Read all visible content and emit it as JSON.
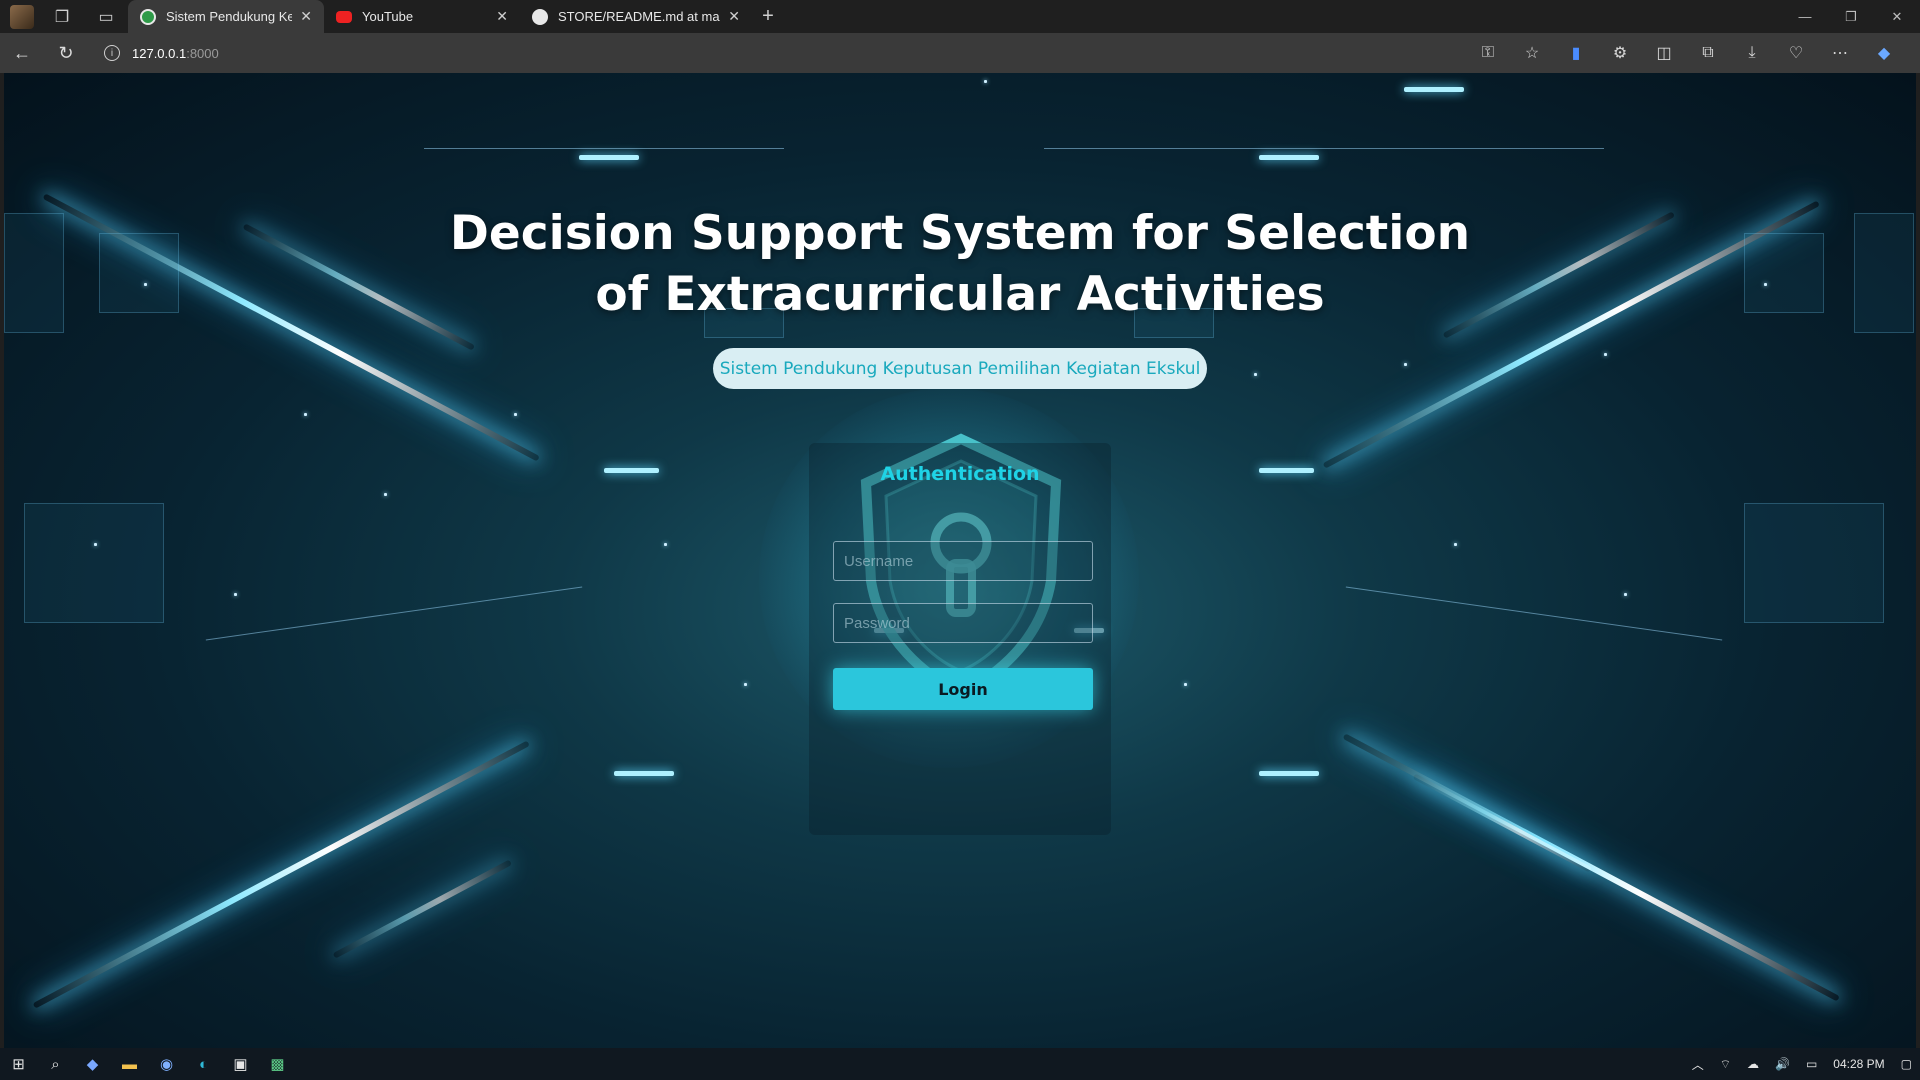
{
  "browser": {
    "tabs": [
      {
        "title": "Sistem Pendukung Keputusan Pe",
        "active": true
      },
      {
        "title": "YouTube",
        "active": false
      },
      {
        "title": "STORE/README.md at master · El",
        "active": false
      }
    ],
    "url_host": "127.0.0.1",
    "url_port": ":8000"
  },
  "page": {
    "title_line1": "Decision Support System for Selection",
    "title_line2": "of Extracurricular Activities",
    "subtitle": "Sistem Pendukung Keputusan Pemilihan Kegiatan Ekskul"
  },
  "auth": {
    "title": "Authentication",
    "username_placeholder": "Username",
    "password_placeholder": "Password",
    "login_label": "Login"
  },
  "taskbar": {
    "time": "04:28 PM"
  },
  "colors": {
    "accent": "#2bc6dc",
    "auth_title": "#1fd3e6",
    "pill_bg": "#d9eef3"
  }
}
